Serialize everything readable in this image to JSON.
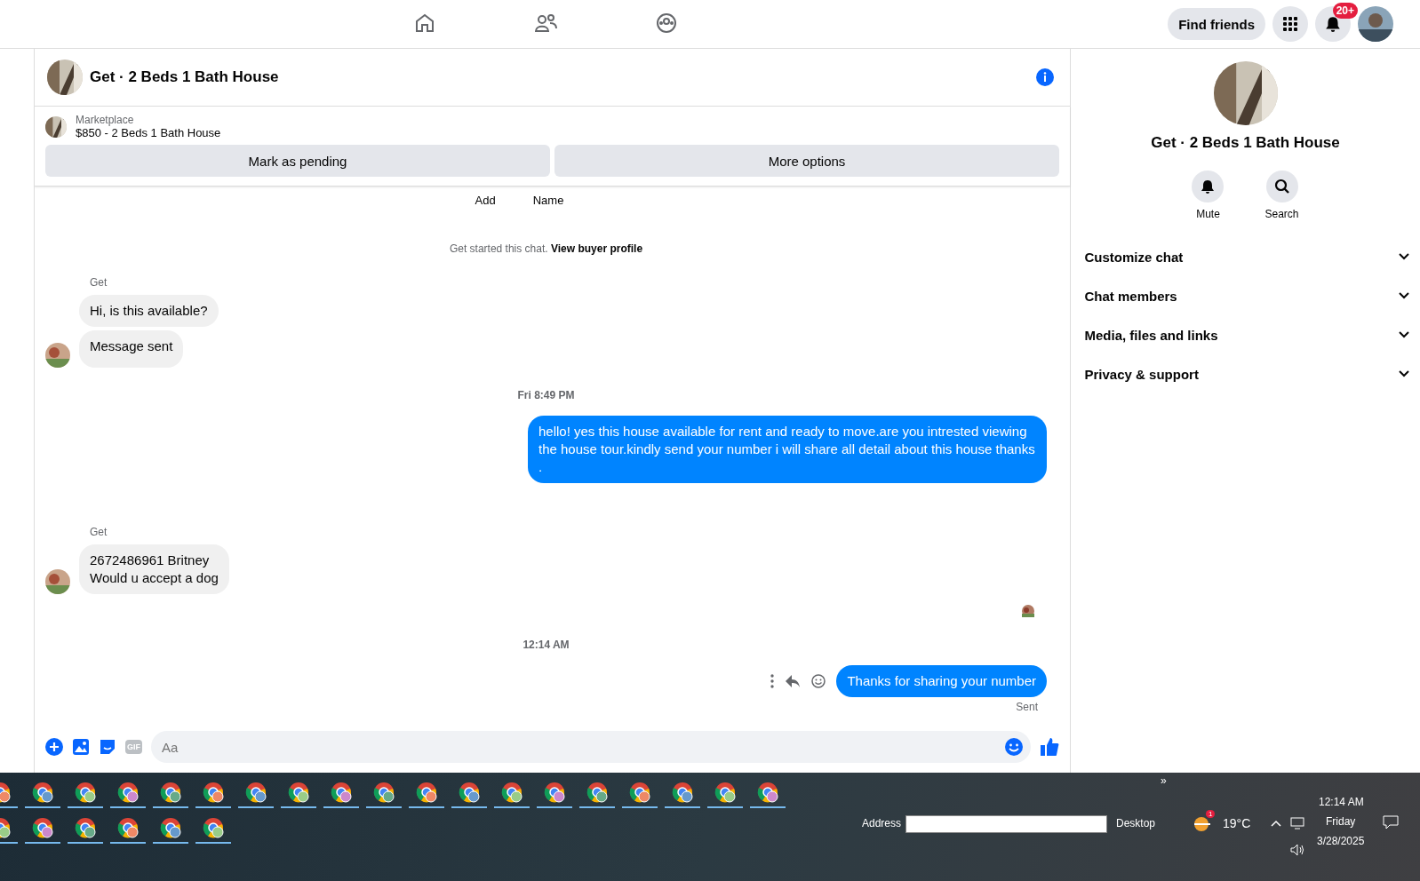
{
  "top_nav": {
    "tabs": [
      {
        "kind": "home",
        "selected": false
      },
      {
        "kind": "friends",
        "selected": false
      },
      {
        "kind": "groups",
        "selected": false
      }
    ],
    "find_friends": "Find friends",
    "notification_badge": "20+"
  },
  "chat": {
    "title": "Get · 2 Beds 1 Bath House",
    "listing": {
      "source": "Marketplace",
      "title": "$850 - 2 Beds 1 Bath House",
      "buttons": [
        "Mark as pending",
        "More options"
      ]
    },
    "column_labels": [
      "Add",
      "Name"
    ],
    "started_note": {
      "text": "Get started this chat.",
      "link": "View buyer profile"
    },
    "items": [
      {
        "kind": "group",
        "sender": "Get",
        "bubbles": [
          "Hi, is this available?",
          "Message sent"
        ]
      },
      {
        "kind": "time",
        "text": "Fri 8:49 PM"
      },
      {
        "kind": "outgoing",
        "text": "hello! yes this house available for rent and ready to move.are you intrested viewing the house tour.kindly send your number i will share all detail about this house thanks ."
      },
      {
        "kind": "group",
        "sender": "Get",
        "bubbles": [
          "2672486961 Britney\nWould u accept a dog"
        ]
      },
      {
        "kind": "seen"
      },
      {
        "kind": "time",
        "text": "12:14 AM"
      },
      {
        "kind": "outgoing_last",
        "text": "Thanks for sharing your number",
        "status": "Sent"
      }
    ],
    "composer": {
      "placeholder": "Aa",
      "gif": "GIF"
    }
  },
  "details": {
    "title": "Get · 2 Beds 1 Bath House",
    "actions": [
      {
        "kind": "mute",
        "label": "Mute"
      },
      {
        "kind": "search",
        "label": "Search"
      }
    ],
    "sections": [
      {
        "label": "Customize chat",
        "expanded": false
      },
      {
        "label": "Chat members",
        "expanded": false
      },
      {
        "label": "Media, files and links",
        "expanded": false
      },
      {
        "label": "Privacy & support",
        "expanded": false
      }
    ]
  },
  "taskbar": {
    "row_1": [
      {
        "kind": "browser"
      },
      {
        "kind": "browser"
      },
      {
        "kind": "browser"
      },
      {
        "kind": "browser"
      },
      {
        "kind": "browser"
      },
      {
        "kind": "browser"
      },
      {
        "kind": "browser"
      },
      {
        "kind": "browser"
      },
      {
        "kind": "browser"
      },
      {
        "kind": "browser"
      },
      {
        "kind": "browser"
      },
      {
        "kind": "browser"
      },
      {
        "kind": "browser"
      },
      {
        "kind": "browser"
      },
      {
        "kind": "browser"
      },
      {
        "kind": "browser"
      },
      {
        "kind": "browser"
      },
      {
        "kind": "browser"
      },
      {
        "kind": "browser"
      }
    ],
    "row_2": [
      {
        "kind": "browser"
      },
      {
        "kind": "browser"
      },
      {
        "kind": "browser"
      },
      {
        "kind": "browser"
      },
      {
        "kind": "browser"
      },
      {
        "kind": "browser"
      }
    ],
    "address_label": "Address",
    "desktop": "Desktop",
    "weather": "19°C",
    "weather_badge": "1",
    "time": "12:14 AM",
    "day": "Friday",
    "date": "3/28/2025",
    "chevron": "»"
  }
}
